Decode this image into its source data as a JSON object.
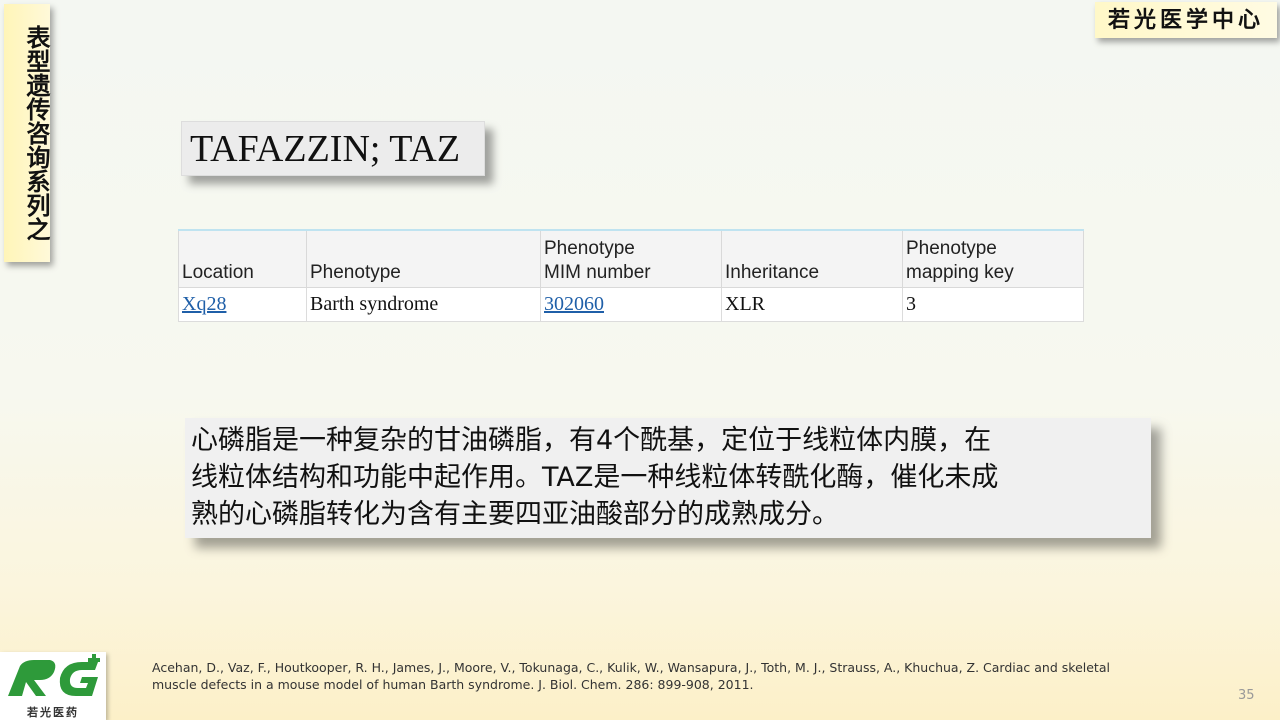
{
  "side_tab": {
    "text": "表型遗传咨询系列之"
  },
  "brand": {
    "text": "若光医学中心"
  },
  "title": {
    "text": "TAFAZZIN; TAZ"
  },
  "table": {
    "headers": [
      "Location",
      "Phenotype",
      "Phenotype MIM number",
      "Inheritance",
      "Phenotype mapping key"
    ],
    "header_lines": [
      [
        "Location"
      ],
      [
        "Phenotype"
      ],
      [
        "Phenotype",
        "MIM number"
      ],
      [
        "Inheritance"
      ],
      [
        "Phenotype",
        "mapping key"
      ]
    ],
    "rows": [
      {
        "location": "Xq28",
        "phenotype": "Barth syndrome",
        "mim_number": "302060",
        "inheritance": "XLR",
        "mapping_key": "3"
      }
    ]
  },
  "description": {
    "lines": [
      "心磷脂是一种复杂的甘油磷脂，有4个酰基，定位于线粒体内膜，在",
      "线粒体结构和功能中起作用。TAZ是一种线粒体转酰化酶，催化未成",
      "熟的心磷脂转化为含有主要四亚油酸部分的成熟成分。"
    ]
  },
  "logo": {
    "name": "若光医药"
  },
  "reference": {
    "lines": [
      "Acehan, D., Vaz, F., Houtkooper, R. H., James, J., Moore, V., Tokunaga, C., Kulik, W., Wansapura, J., Toth, M. J., Strauss, A., Khuchua, Z. Cardiac and skeletal",
      "muscle defects in a mouse model of human Barth syndrome. J. Biol. Chem. 286: 899-908, 2011."
    ]
  },
  "page_number": "35",
  "colors": {
    "link": "#1f5fa8",
    "logo_green": "#2e9a3a",
    "tab_yellow": "#fff5b8"
  }
}
